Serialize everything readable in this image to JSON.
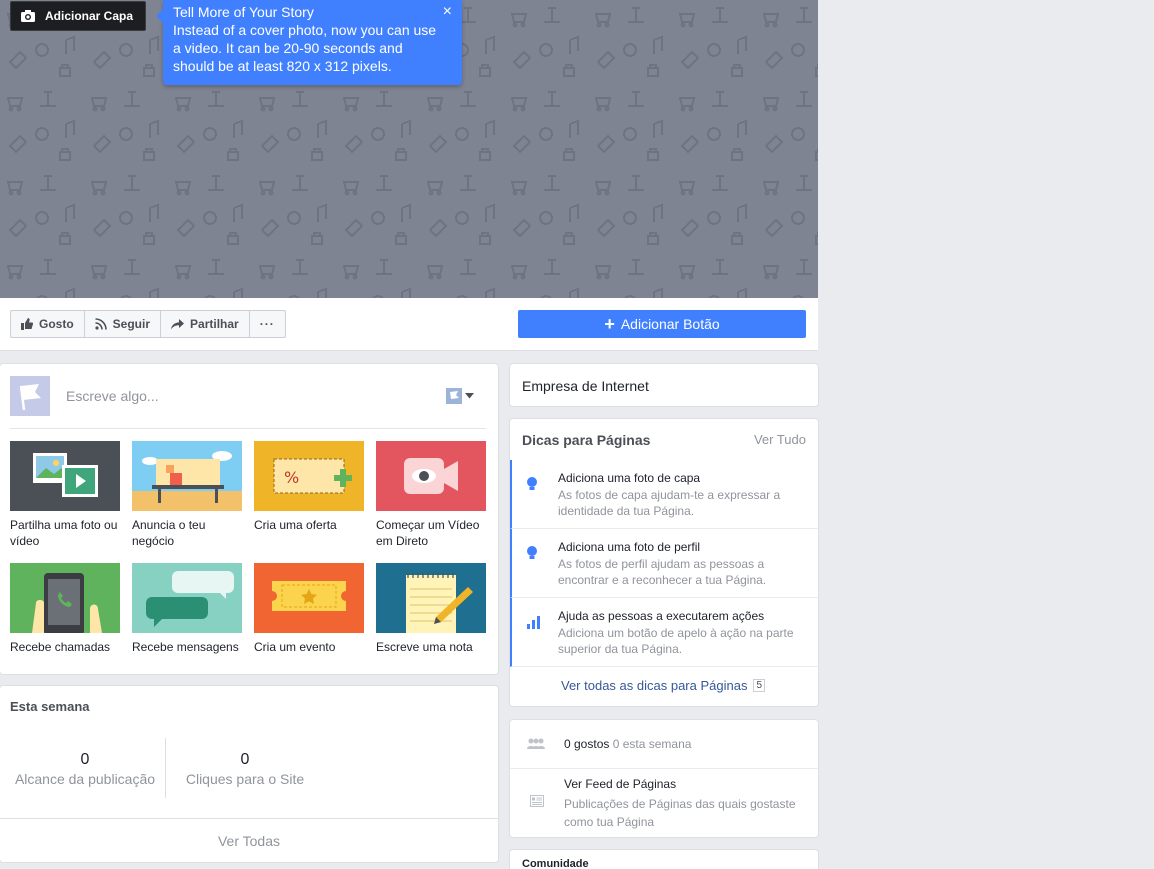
{
  "cover": {
    "add_cover_label": "Adicionar Capa",
    "tooltip": {
      "title": "Tell More of Your Story",
      "body": "Instead of a cover photo, now you can use a video. It can be 20-90 seconds and should be at least 820 x 312 pixels.",
      "close": "×"
    }
  },
  "actions": {
    "like": "Gosto",
    "follow": "Seguir",
    "share": "Partilhar",
    "more": "···",
    "add_button": "Adicionar Botão",
    "add_button_plus": "+"
  },
  "composer": {
    "placeholder": "Escreve algo...",
    "tiles": [
      {
        "label": "Partilha uma foto ou vídeo",
        "icon": "photo-video-icon"
      },
      {
        "label": "Anuncia o teu negócio",
        "icon": "advertise-icon"
      },
      {
        "label": "Cria uma oferta",
        "icon": "offer-icon"
      },
      {
        "label": "Começar um Vídeo em Direto",
        "icon": "live-video-icon"
      },
      {
        "label": "Recebe chamadas",
        "icon": "phone-call-icon"
      },
      {
        "label": "Recebe mensagens",
        "icon": "messages-icon"
      },
      {
        "label": "Cria um evento",
        "icon": "event-ticket-icon"
      },
      {
        "label": "Escreve uma nota",
        "icon": "note-icon"
      }
    ]
  },
  "stats": {
    "title": "Esta semana",
    "reach_value": "0",
    "reach_label": "Alcance da publicação",
    "clicks_value": "0",
    "clicks_label": "Cliques para o Site",
    "footer": "Ver Todas"
  },
  "sidebar": {
    "category": "Empresa de Internet",
    "tips": {
      "title": "Dicas para Páginas",
      "see_all": "Ver Tudo",
      "items": [
        {
          "title": "Adiciona uma foto de capa",
          "desc": "As fotos de capa ajudam-te a expressar a identidade da tua Página."
        },
        {
          "title": "Adiciona uma foto de perfil",
          "desc": "As fotos de perfil ajudam as pessoas a encontrar e a reconhecer a tua Página."
        },
        {
          "title": "Ajuda as pessoas a executarem ações",
          "desc": "Adiciona um botão de apelo à ação na parte superior da tua Página."
        }
      ],
      "more": "Ver todas as dicas para Páginas",
      "count": "5"
    },
    "likes": {
      "count": "0 gostos",
      "week": "0 esta semana",
      "feed_title": "Ver Feed de Páginas",
      "feed_desc": "Publicações de Páginas das quais gostaste como tua Página"
    },
    "community": "Comunidade"
  },
  "colors": {
    "accent": "#4080ff",
    "cover_bg": "#7f8493",
    "page_bg": "#e9ebee",
    "link": "#365899"
  }
}
